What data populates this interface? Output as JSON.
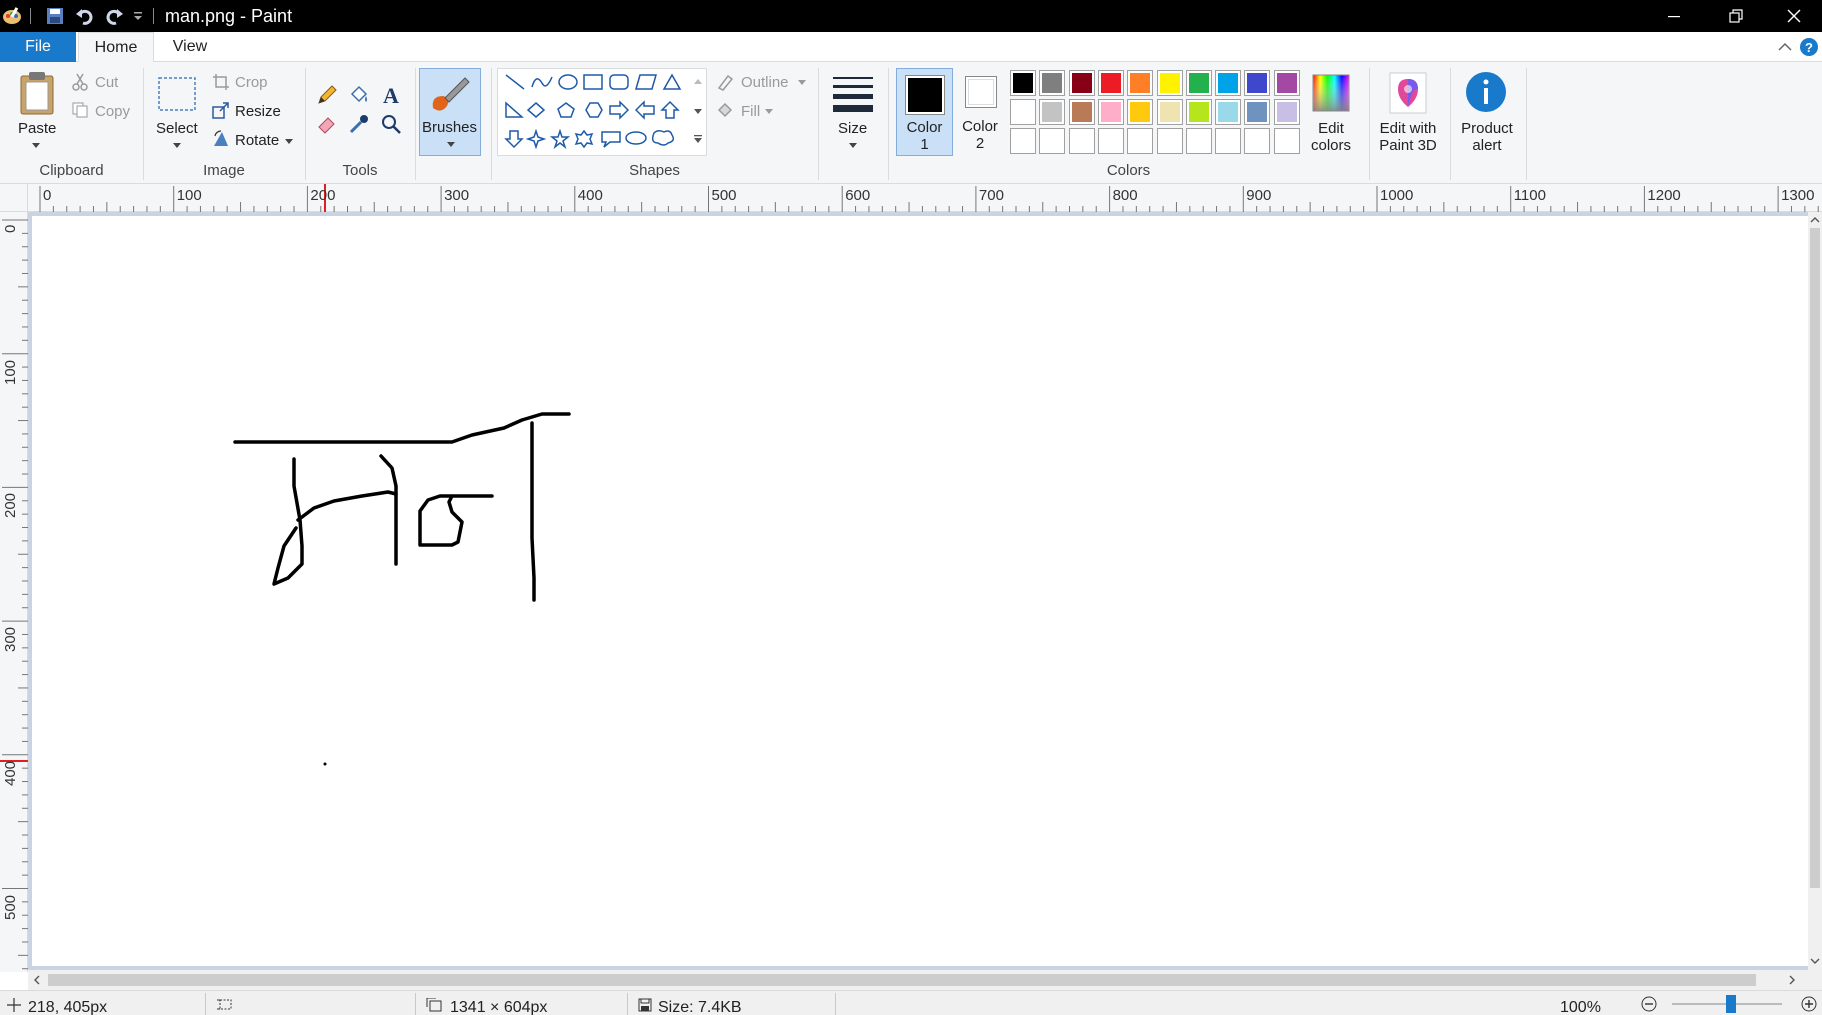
{
  "window": {
    "title": "man.png - Paint"
  },
  "tabs": {
    "file": "File",
    "home": "Home",
    "view": "View"
  },
  "clipboard": {
    "group": "Clipboard",
    "paste": "Paste",
    "cut": "Cut",
    "copy": "Copy"
  },
  "image": {
    "group": "Image",
    "select": "Select",
    "crop": "Crop",
    "resize": "Resize",
    "rotate": "Rotate"
  },
  "tools": {
    "group": "Tools"
  },
  "brushes": {
    "label": "Brushes"
  },
  "shapes": {
    "group": "Shapes",
    "outline": "Outline",
    "fill": "Fill"
  },
  "size": {
    "label": "Size"
  },
  "colors": {
    "group": "Colors",
    "color1_line1": "Color",
    "color1_line2": "1",
    "color2_line1": "Color",
    "color2_line2": "2",
    "edit_line1": "Edit",
    "edit_line2": "colors",
    "paint3d_line1": "Edit with",
    "paint3d_line2": "Paint 3D",
    "alert_line1": "Product",
    "alert_line2": "alert",
    "color1_value": "#000000",
    "color2_value": "#ffffff",
    "palette_row1": [
      "#000000",
      "#7f7f7f",
      "#880015",
      "#ed1c24",
      "#ff7f27",
      "#fff200",
      "#22b14c",
      "#00a2e8",
      "#3f48cc",
      "#a349a4"
    ],
    "palette_row2": [
      "#ffffff",
      "#c3c3c3",
      "#b97a57",
      "#ffaec9",
      "#ffc90e",
      "#efe4b0",
      "#b5e61d",
      "#99d9ea",
      "#7092be",
      "#c8bfe7"
    ],
    "palette_row3": [
      "#ffffff",
      "#ffffff",
      "#ffffff",
      "#ffffff",
      "#ffffff",
      "#ffffff",
      "#ffffff",
      "#ffffff",
      "#ffffff",
      "#ffffff"
    ]
  },
  "ruler": {
    "h": [
      "0",
      "100",
      "200",
      "300",
      "400",
      "500",
      "600",
      "700",
      "800",
      "900",
      "1000",
      "1100",
      "1200",
      "1300"
    ],
    "v": [
      "0",
      "100",
      "200",
      "300",
      "400",
      "500"
    ]
  },
  "status": {
    "cursor": "218, 405px",
    "selection": "",
    "image_size": "1341 × 604px",
    "file_size": "Size: 7.4KB",
    "zoom": "100%"
  }
}
